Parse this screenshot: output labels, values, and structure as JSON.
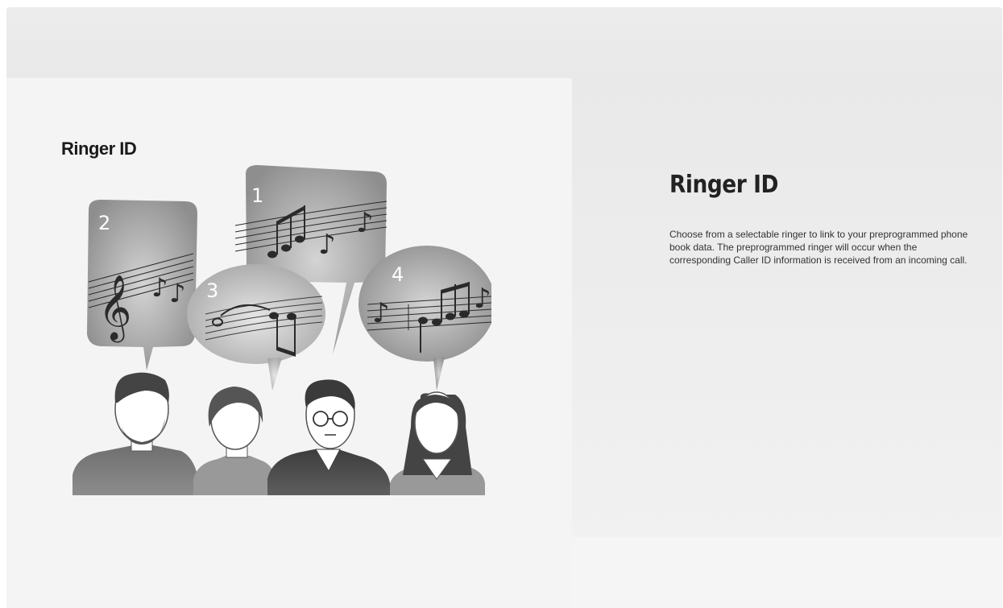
{
  "illustration": {
    "title": "Ringer ID",
    "bubbles": [
      {
        "number": "1"
      },
      {
        "number": "2"
      },
      {
        "number": "3"
      },
      {
        "number": "4"
      }
    ]
  },
  "feature": {
    "title": "Ringer ID",
    "description": "Choose from a selectable ringer to link to your preprogrammed phone book data. The preprogrammed ringer will occur when the corresponding Caller ID information is received from an incoming call."
  }
}
